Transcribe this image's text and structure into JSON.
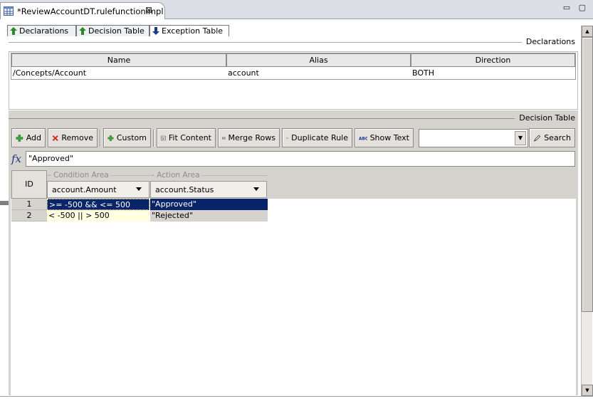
{
  "editor": {
    "tab_title": "*ReviewAccountDT.rulefunctionimpl",
    "close_glyph": "⊠",
    "window_controls": "▭ ▢"
  },
  "subtabs": [
    {
      "label": "Declarations",
      "icon": "arrow-up-icon",
      "color": "#2a8a2a"
    },
    {
      "label": "Decision Table",
      "icon": "arrow-up-icon",
      "color": "#2a8a2a"
    },
    {
      "label": "Exception Table",
      "icon": "arrow-down-icon",
      "color": "#1a3a8a"
    }
  ],
  "declarations": {
    "section_title": "Declarations",
    "columns": [
      "Name",
      "Alias",
      "Direction"
    ],
    "rows": [
      {
        "name": "/Concepts/Account",
        "alias": "account",
        "direction": "BOTH"
      }
    ]
  },
  "decision_table": {
    "section_title": "Decision Table",
    "toolbar": {
      "add": "Add",
      "remove": "Remove",
      "custom": "Custom",
      "fit_content": "Fit Content",
      "merge_rows": "Merge Rows",
      "duplicate_rule": "Duplicate Rule",
      "show_text": "Show Text",
      "search": "Search",
      "search_value": ""
    },
    "formula_label": "fx",
    "formula_value": "\"Approved\"",
    "id_header": "ID",
    "condition_area": "Condition Area",
    "action_area": "Action Area",
    "condition_column": "account.Amount",
    "action_column": "account.Status",
    "rows": [
      {
        "id": "1",
        "condition": ">= -500 && <= 500",
        "action": "\"Approved\""
      },
      {
        "id": "2",
        "condition": "< -500 || > 500",
        "action": "\"Rejected\""
      }
    ]
  },
  "colors": {
    "selection": "#0a246a",
    "condition_cell": "#ffffe1",
    "panel": "#d6d3ce"
  }
}
